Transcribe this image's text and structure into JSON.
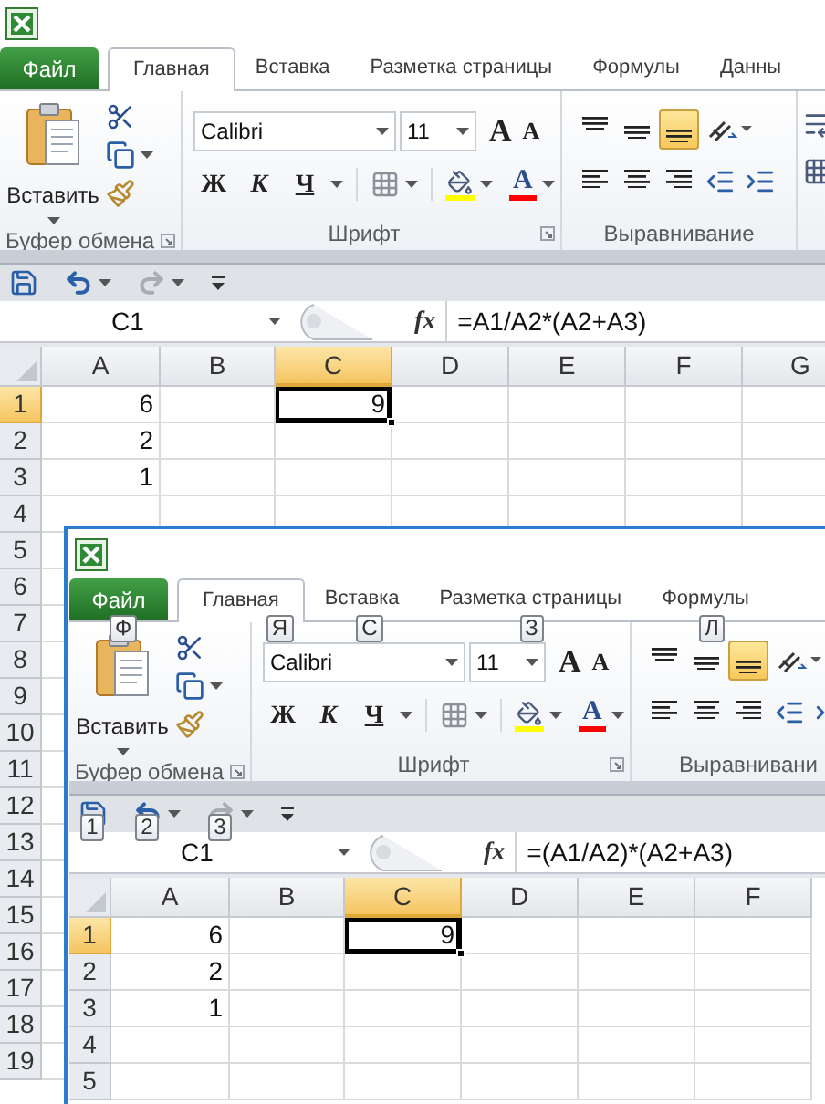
{
  "windows": [
    {
      "tabs": [
        {
          "label": "Файл",
          "kind": "file",
          "selected": false
        },
        {
          "label": "Главная",
          "kind": "tab",
          "selected": true
        },
        {
          "label": "Вставка",
          "kind": "tab",
          "selected": false
        },
        {
          "label": "Разметка страницы",
          "kind": "tab",
          "selected": false
        },
        {
          "label": "Формулы",
          "kind": "tab",
          "selected": false
        },
        {
          "label": "Данны",
          "kind": "tab",
          "selected": false
        }
      ],
      "clipboard": {
        "paste_label": "Вставить",
        "group_label": "Буфер обмена"
      },
      "font": {
        "name": "Calibri",
        "size": "11",
        "grow_label": "A",
        "shrink_label": "A",
        "bold_label": "Ж",
        "italic_label": "К",
        "underline_label": "Ч",
        "color_label": "A",
        "group_label": "Шрифт"
      },
      "alignment": {
        "group_label": "Выравнивание",
        "vertical": [
          {
            "kind": "top",
            "selected": false
          },
          {
            "kind": "middle",
            "selected": false
          },
          {
            "kind": "bottom",
            "selected": true
          }
        ]
      },
      "quick_access": [
        {
          "kind": "save",
          "disabled": false
        },
        {
          "kind": "undo",
          "disabled": false
        },
        {
          "kind": "redo",
          "disabled": true
        }
      ],
      "name_box": "C1",
      "function_label": "fx",
      "formula": "=A1/A2*(A2+A3)",
      "columns": [
        {
          "label": "A",
          "selected": false
        },
        {
          "label": "B",
          "selected": false
        },
        {
          "label": "C",
          "selected": true
        },
        {
          "label": "D",
          "selected": false
        },
        {
          "label": "E",
          "selected": false
        },
        {
          "label": "F",
          "selected": false
        },
        {
          "label": "G",
          "selected": false
        }
      ],
      "rows": [
        {
          "label": "1",
          "selected": true,
          "cells": {
            "column_a": {
              "value": "6",
              "active": false
            },
            "column_c": {
              "value": "9",
              "active": true
            }
          }
        },
        {
          "label": "2",
          "selected": false,
          "cells": {
            "column_a": {
              "value": "2",
              "active": false
            }
          }
        },
        {
          "label": "3",
          "selected": false,
          "cells": {
            "column_a": {
              "value": "1",
              "active": false
            }
          }
        },
        {
          "label": "4",
          "selected": false
        },
        {
          "label": "5",
          "selected": false
        },
        {
          "label": "6",
          "selected": false
        },
        {
          "label": "7",
          "selected": false
        },
        {
          "label": "8",
          "selected": false
        },
        {
          "label": "9",
          "selected": false
        },
        {
          "label": "10",
          "selected": false
        },
        {
          "label": "11",
          "selected": false
        },
        {
          "label": "12",
          "selected": false
        },
        {
          "label": "13",
          "selected": false
        },
        {
          "label": "14",
          "selected": false
        },
        {
          "label": "15",
          "selected": false
        },
        {
          "label": "16",
          "selected": false
        },
        {
          "label": "17",
          "selected": false
        },
        {
          "label": "18",
          "selected": false
        },
        {
          "label": "19",
          "selected": false
        }
      ]
    },
    {
      "tabs": [
        {
          "label": "Файл",
          "kind": "file",
          "selected": false,
          "key_tip": "Ф"
        },
        {
          "label": "Главная",
          "kind": "tab",
          "selected": true,
          "key_tip": "Я"
        },
        {
          "label": "Вставка",
          "kind": "tab",
          "selected": false,
          "key_tip": "С"
        },
        {
          "label": "Разметка страницы",
          "kind": "tab",
          "selected": false,
          "key_tip": "З"
        },
        {
          "label": "Формулы",
          "kind": "tab",
          "selected": false,
          "key_tip": "Л"
        }
      ],
      "clipboard": {
        "paste_label": "Вставить",
        "group_label": "Буфер обмена"
      },
      "font": {
        "name": "Calibri",
        "size": "11",
        "grow_label": "A",
        "shrink_label": "A",
        "bold_label": "Ж",
        "italic_label": "К",
        "underline_label": "Ч",
        "color_label": "A",
        "group_label": "Шрифт"
      },
      "alignment": {
        "group_label": "Выравнивани",
        "vertical": [
          {
            "kind": "top",
            "selected": false
          },
          {
            "kind": "middle",
            "selected": false
          },
          {
            "kind": "bottom",
            "selected": true
          }
        ]
      },
      "quick_access": [
        {
          "kind": "save",
          "disabled": false,
          "key_tip": "1"
        },
        {
          "kind": "undo",
          "disabled": false,
          "key_tip": "2"
        },
        {
          "kind": "redo",
          "disabled": true,
          "key_tip": "3"
        }
      ],
      "name_box": "C1",
      "function_label": "fx",
      "formula": "=(A1/A2)*(A2+A3)",
      "columns": [
        {
          "label": "A",
          "selected": false
        },
        {
          "label": "B",
          "selected": false
        },
        {
          "label": "C",
          "selected": true
        },
        {
          "label": "D",
          "selected": false
        },
        {
          "label": "E",
          "selected": false
        },
        {
          "label": "F",
          "selected": false
        }
      ],
      "rows": [
        {
          "label": "1",
          "selected": true,
          "cells": {
            "column_a": {
              "value": "6",
              "active": false
            },
            "column_c": {
              "value": "9",
              "active": true
            }
          }
        },
        {
          "label": "2",
          "selected": false,
          "cells": {
            "column_a": {
              "value": "2",
              "active": false
            }
          }
        },
        {
          "label": "3",
          "selected": false,
          "cells": {
            "column_a": {
              "value": "1",
              "active": false
            }
          }
        },
        {
          "label": "4",
          "selected": false
        },
        {
          "label": "5",
          "selected": false
        }
      ]
    }
  ]
}
